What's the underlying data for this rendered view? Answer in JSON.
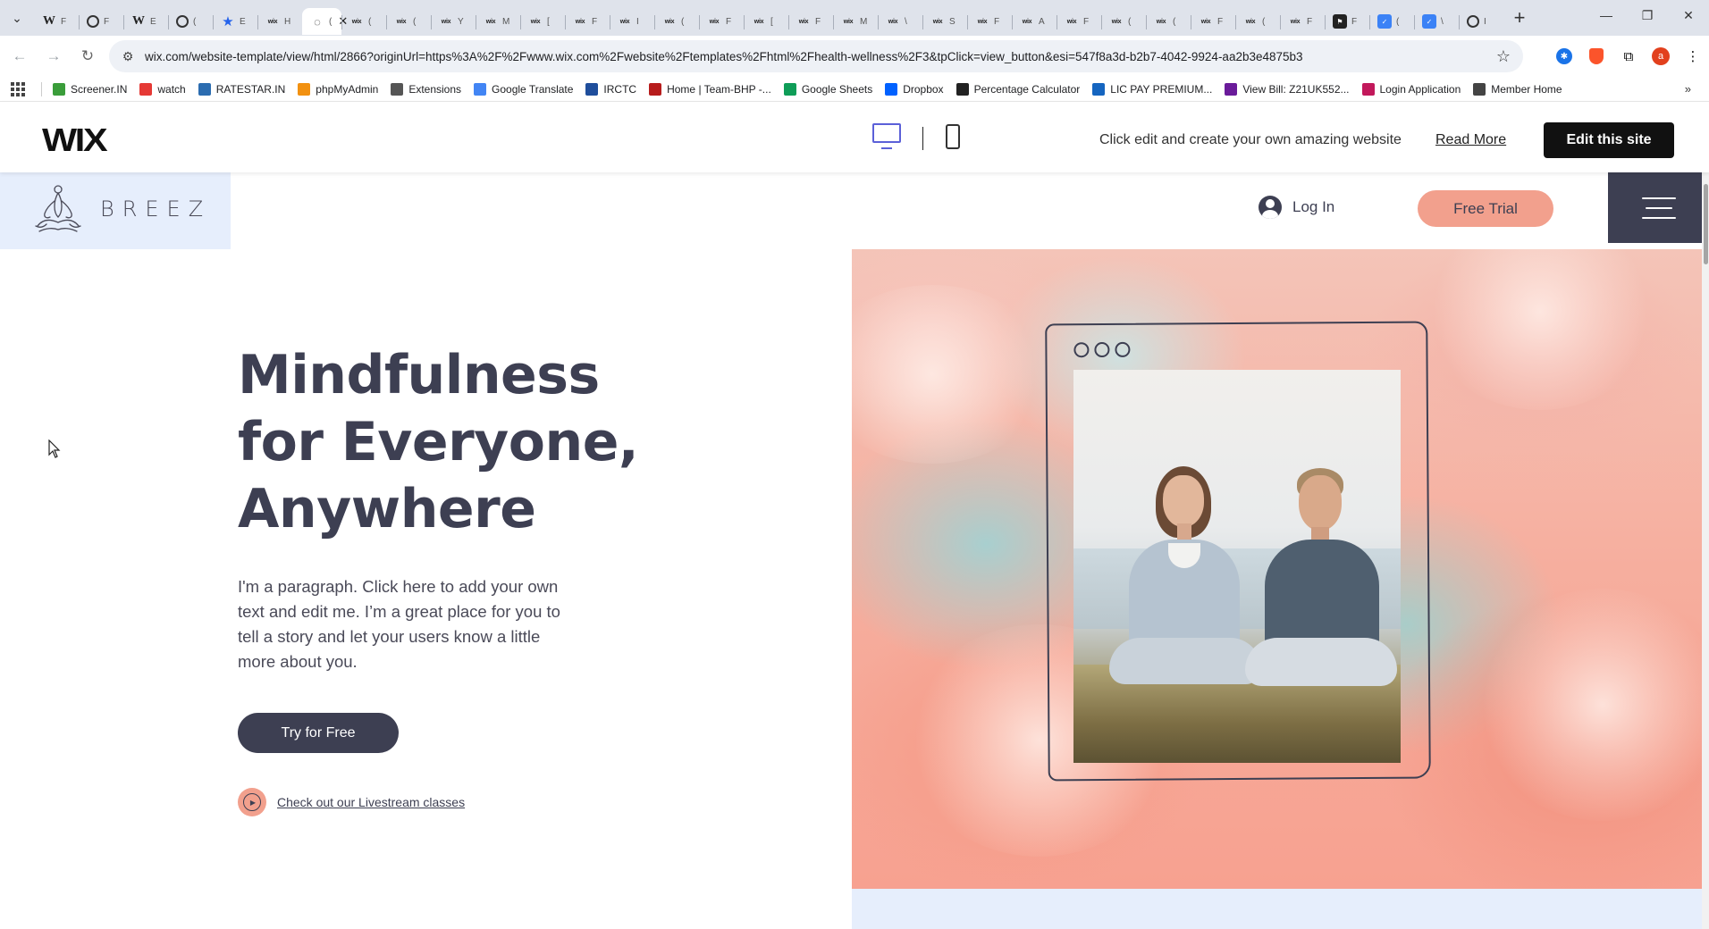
{
  "browser": {
    "tabs": [
      {
        "icon": "wikipedia-icon",
        "letter": "F"
      },
      {
        "icon": "globe-icon",
        "letter": "F"
      },
      {
        "icon": "wikipedia-icon",
        "letter": "E"
      },
      {
        "icon": "openai-icon",
        "letter": "("
      },
      {
        "icon": "star-icon",
        "letter": "E"
      },
      {
        "icon": "wix-icon",
        "letter": "H"
      },
      {
        "icon": "loading-icon",
        "letter": "(",
        "active": true
      },
      {
        "icon": "wix-icon",
        "letter": "("
      },
      {
        "icon": "wix-icon",
        "letter": "("
      },
      {
        "icon": "wix-icon",
        "letter": "Y"
      },
      {
        "icon": "wix-icon",
        "letter": "M"
      },
      {
        "icon": "wix-icon",
        "letter": "["
      },
      {
        "icon": "wix-icon",
        "letter": "F"
      },
      {
        "icon": "wix-icon",
        "letter": "I"
      },
      {
        "icon": "wix-icon",
        "letter": "("
      },
      {
        "icon": "wix-icon",
        "letter": "F"
      },
      {
        "icon": "wix-icon",
        "letter": "["
      },
      {
        "icon": "wix-icon",
        "letter": "F"
      },
      {
        "icon": "wix-icon",
        "letter": "M"
      },
      {
        "icon": "wix-icon",
        "letter": "\\"
      },
      {
        "icon": "wix-icon",
        "letter": "S"
      },
      {
        "icon": "wix-icon",
        "letter": "F"
      },
      {
        "icon": "wix-icon",
        "letter": "A"
      },
      {
        "icon": "wix-icon",
        "letter": "F"
      },
      {
        "icon": "wix-icon",
        "letter": "("
      },
      {
        "icon": "wix-icon",
        "letter": "("
      },
      {
        "icon": "wix-icon",
        "letter": "F"
      },
      {
        "icon": "wix-icon",
        "letter": "("
      },
      {
        "icon": "wix-icon",
        "letter": "F"
      },
      {
        "icon": "dark-icon",
        "letter": "F"
      },
      {
        "icon": "blue-icon",
        "letter": "("
      },
      {
        "icon": "blue-icon",
        "letter": "\\"
      },
      {
        "icon": "chrome-icon",
        "letter": "I"
      }
    ],
    "url": "wix.com/website-template/view/html/2866?originUrl=https%3A%2F%2Fwww.wix.com%2Fwebsite%2Ftemplates%2Fhtml%2Fhealth-wellness%2F3&tpClick=view_button&esi=547f8a3d-b2b7-4042-9924-aa2b3e4875b3",
    "profile_initial": "a",
    "bookmarks": [
      {
        "label": "Screener.IN",
        "icon": "bar-chart-icon",
        "color": "#3a9d3a"
      },
      {
        "label": "watch",
        "icon": "youtube-icon",
        "color": "#e53935"
      },
      {
        "label": "RATESTAR.IN",
        "icon": "rates-icon",
        "color": "#2b6cb0"
      },
      {
        "label": "phpMyAdmin",
        "icon": "phpmyadmin-icon",
        "color": "#f29111"
      },
      {
        "label": "Extensions",
        "icon": "puzzle-icon",
        "color": "#555555"
      },
      {
        "label": "Google Translate",
        "icon": "translate-icon",
        "color": "#4285f4"
      },
      {
        "label": "IRCTC",
        "icon": "irctc-icon",
        "color": "#1f4e9c"
      },
      {
        "label": "Home | Team-BHP -...",
        "icon": "teambhp-icon",
        "color": "#b71c1c"
      },
      {
        "label": "Google Sheets",
        "icon": "sheets-icon",
        "color": "#0f9d58"
      },
      {
        "label": "Dropbox",
        "icon": "dropbox-icon",
        "color": "#0061ff"
      },
      {
        "label": "Percentage Calculator",
        "icon": "percent-icon",
        "color": "#222222"
      },
      {
        "label": "LIC PAY PREMIUM...",
        "icon": "lic-icon",
        "color": "#1565c0"
      },
      {
        "label": "View Bill: Z21UK552...",
        "icon": "bill-icon",
        "color": "#6a1b9a"
      },
      {
        "label": "Login Application",
        "icon": "login-icon",
        "color": "#c2185b"
      },
      {
        "label": "Member Home",
        "icon": "member-icon",
        "color": "#444444"
      }
    ]
  },
  "wixbar": {
    "logo": "WIX",
    "message": "Click edit and create your own amazing website",
    "read_more": "Read More",
    "edit_button": "Edit this site"
  },
  "site": {
    "brand": "BREEZ",
    "login_label": "Log In",
    "trial_button": "Free Trial",
    "headline": [
      "Mindfulness",
      "for Everyone,",
      "Anywhere"
    ],
    "paragraph": "I'm a paragraph. Click here to add your own text and edit me. I’m a great place for you to tell a story and let your users know a little more about you.",
    "try_button": "Try for Free",
    "livestream_link": "Check out our Livestream classes"
  },
  "colors": {
    "primary": "#3d3f52",
    "accent": "#f2a08d",
    "logo_bg": "#e6eefc",
    "wix_accent": "#5b60d8"
  }
}
